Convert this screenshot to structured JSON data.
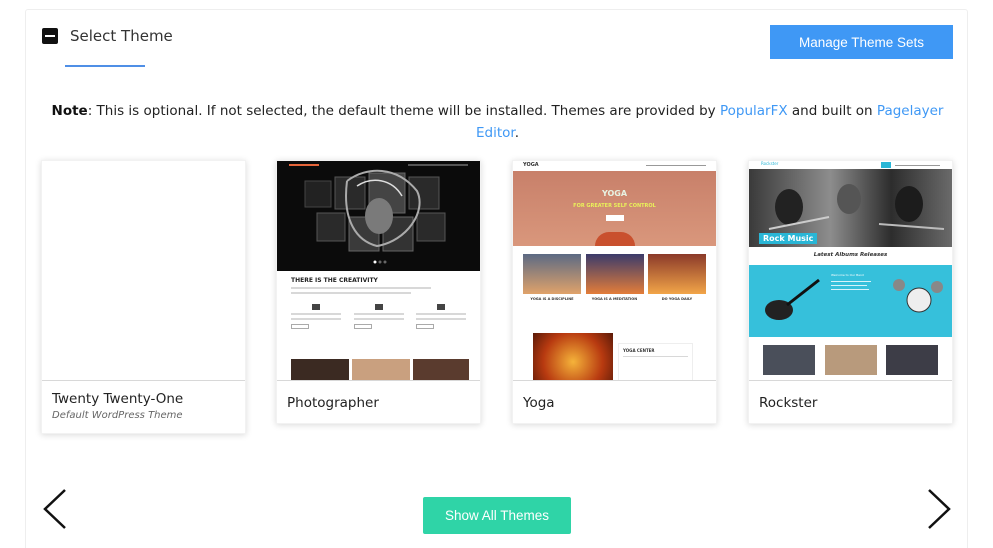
{
  "header": {
    "title": "Select Theme",
    "manage_button": "Manage Theme Sets"
  },
  "note": {
    "label": "Note",
    "text_1": ": This is optional. If not selected, the default theme will be installed. Themes are provided by ",
    "link_1": "PopularFX",
    "text_2": " and built on ",
    "link_2": "Pagelayer Editor",
    "text_3": "."
  },
  "themes": [
    {
      "name": "Twenty Twenty-One",
      "subtitle": "Default WordPress Theme"
    },
    {
      "name": "Photographer",
      "thumb_heading": "THERE IS THE CREATIVITY"
    },
    {
      "name": "Yoga",
      "thumb_heading": "YOGA",
      "thumb_tagline": "FOR GREATER SELF CONTROL",
      "thumb_nav": "YOGA",
      "thumb_captions": [
        "YOGA IS A DISCIPLINE",
        "YOGA IS A MEDITATION",
        "DO YOGA DAILY"
      ],
      "thumb_center": "YOGA CENTER"
    },
    {
      "name": "Rockster",
      "thumb_badge": "Rock Music",
      "thumb_heading": "Latest Albums Releases",
      "thumb_brand": "Rockster",
      "thumb_panel": "Welcome to Our Band"
    }
  ],
  "footer": {
    "show_all_button": "Show All Themes"
  },
  "colors": {
    "accent_blue": "#3f98f5",
    "show_all_green": "#2fd4a7"
  }
}
